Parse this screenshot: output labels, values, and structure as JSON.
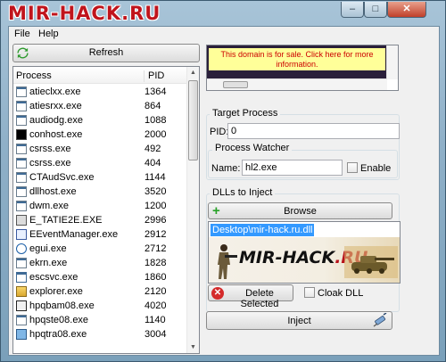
{
  "window": {
    "title": "MIR-HACK.RU",
    "min": "–",
    "max": "□",
    "close": "✕"
  },
  "menu": [
    "File",
    "Help"
  ],
  "refresh_label": "Refresh",
  "list": {
    "col_process": "Process",
    "col_pid": "PID",
    "rows": [
      {
        "name": "atieclxx.exe",
        "pid": "1364",
        "icon": "generic-app-icon"
      },
      {
        "name": "atiesrxx.exe",
        "pid": "864",
        "icon": "generic-app-icon"
      },
      {
        "name": "audiodg.exe",
        "pid": "1088",
        "icon": "generic-app-icon"
      },
      {
        "name": "conhost.exe",
        "pid": "2000",
        "icon": "console-icon"
      },
      {
        "name": "csrss.exe",
        "pid": "492",
        "icon": "generic-app-icon"
      },
      {
        "name": "csrss.exe",
        "pid": "404",
        "icon": "generic-app-icon"
      },
      {
        "name": "CTAudSvc.exe",
        "pid": "1144",
        "icon": "generic-app-icon"
      },
      {
        "name": "dllhost.exe",
        "pid": "3520",
        "icon": "generic-app-icon"
      },
      {
        "name": "dwm.exe",
        "pid": "1200",
        "icon": "generic-app-icon"
      },
      {
        "name": "E_TATIE2E.EXE",
        "pid": "2996",
        "icon": "printer-icon"
      },
      {
        "name": "EEventManager.exe",
        "pid": "2912",
        "icon": "event-manager-icon"
      },
      {
        "name": "egui.exe",
        "pid": "2712",
        "icon": "eset-icon"
      },
      {
        "name": "ekrn.exe",
        "pid": "1828",
        "icon": "generic-app-icon"
      },
      {
        "name": "escsvc.exe",
        "pid": "1860",
        "icon": "service-window-icon"
      },
      {
        "name": "explorer.exe",
        "pid": "2120",
        "icon": "explorer-icon"
      },
      {
        "name": "hpqbam08.exe",
        "pid": "4020",
        "icon": "hp-pen-icon"
      },
      {
        "name": "hpqste08.exe",
        "pid": "1140",
        "icon": "generic-app-icon"
      },
      {
        "name": "hpqtra08.exe",
        "pid": "3004",
        "icon": "hp-tray-icon"
      }
    ]
  },
  "ad": {
    "text": "This domain is for sale. Click here for more information."
  },
  "target": {
    "legend": "Target Process",
    "pid_label": "PID:",
    "pid_value": "0",
    "watcher_legend": "Process Watcher",
    "name_label": "Name:",
    "name_value": "hl2.exe",
    "enable_label": "Enable"
  },
  "dlls": {
    "legend": "DLLs to Inject",
    "browse_label": "Browse",
    "items": [
      "Desktop\\mir-hack.ru.dll"
    ],
    "logo_text": "MIR-HACK.RU",
    "delete_label": "Delete Selected",
    "cloak_label": "Cloak DLL"
  },
  "inject_label": "Inject",
  "colors": {
    "title_red": "#c0141c",
    "selection": "#3399ff",
    "ad_text": "#cc0000",
    "ad_bg": "#ffff99"
  }
}
